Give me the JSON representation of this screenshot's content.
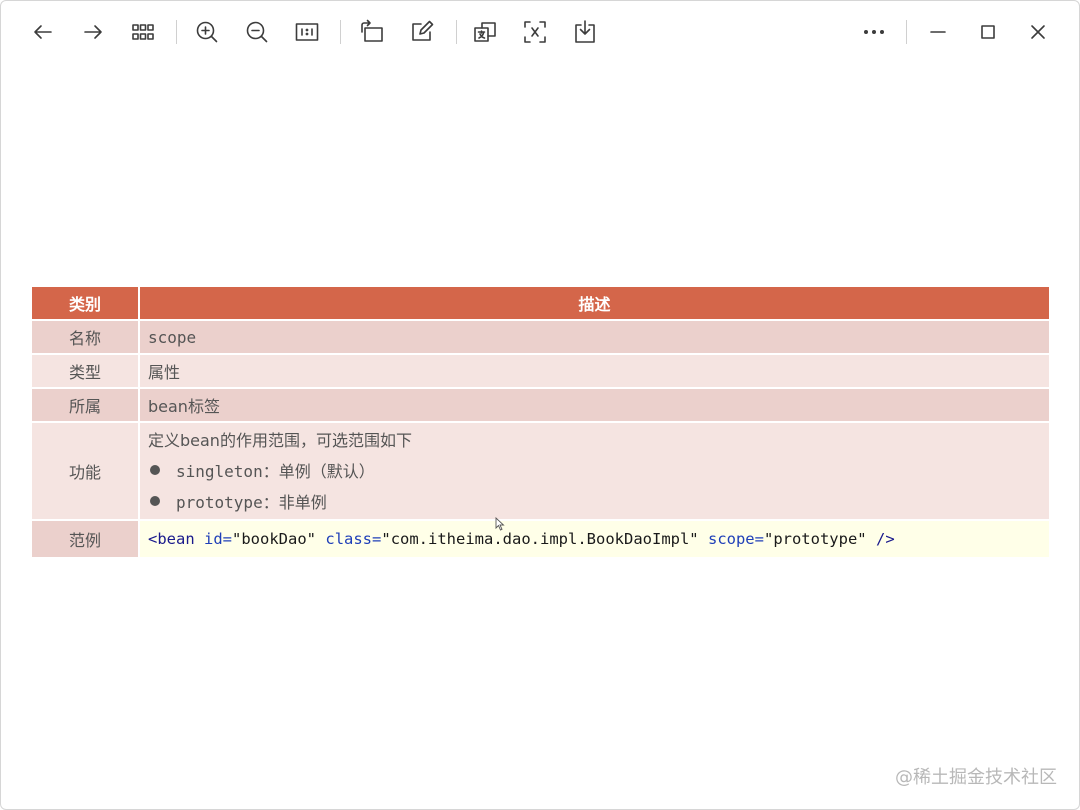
{
  "toolbar": {
    "back": "back-arrow-icon",
    "forward": "forward-arrow-icon",
    "grid": "grid-icon",
    "zoom_in": "zoom-in-icon",
    "zoom_out": "zoom-out-icon",
    "actual_size": "actual-size-icon",
    "rotate": "rotate-icon",
    "edit": "edit-icon",
    "translate": "translate-icon",
    "ocr": "text-recognition-icon",
    "download": "download-icon",
    "more": "more-icon",
    "minimize": "minimize-icon",
    "maximize": "maximize-icon",
    "close": "close-icon"
  },
  "table": {
    "header": {
      "category": "类别",
      "description": "描述"
    },
    "rows": {
      "name": {
        "label": "名称",
        "value": "scope"
      },
      "type": {
        "label": "类型",
        "value": "属性"
      },
      "belongs": {
        "label": "所属",
        "value": "bean标签"
      },
      "function": {
        "label": "功能",
        "intro": "定义bean的作用范围，可选范围如下",
        "items": [
          {
            "keyword": "singleton",
            "sep": "：",
            "text": "单例（默认）"
          },
          {
            "keyword": "prototype",
            "sep": "：",
            "text": "非单例"
          }
        ]
      },
      "example": {
        "label": "范例",
        "code": {
          "open": "<bean",
          "id_attr": "id=",
          "id_val": "\"bookDao\"",
          "class_attr": "class=",
          "class_val": "\"com.itheima.dao.impl.BookDaoImpl\"",
          "scope_attr": "scope=",
          "scope_val": "\"prototype\"",
          "close": "/>"
        }
      }
    }
  },
  "watermark": "@稀土掘金技术社区",
  "colors": {
    "header_bg": "#d4664a",
    "row_dark": "#ebd0cc",
    "row_light": "#f5e4e1",
    "code_bg": "#ffffe8"
  }
}
